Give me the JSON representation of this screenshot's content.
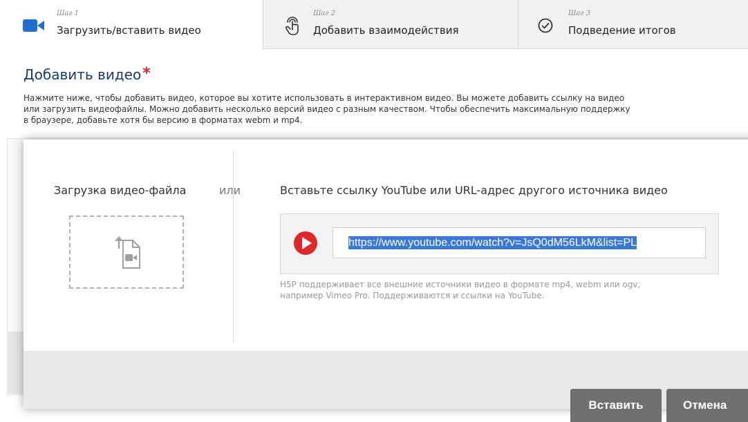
{
  "tabs": [
    {
      "step": "Шаг 1",
      "label": "Загрузить/вставить видео",
      "icon": "video-camera-icon",
      "active": true
    },
    {
      "step": "Шаг 2",
      "label": "Добавить взаимодействия",
      "icon": "tap-gesture-icon",
      "active": false
    },
    {
      "step": "Шаг 3",
      "label": "Подведение итогов",
      "icon": "check-circle-icon",
      "active": false
    }
  ],
  "page": {
    "title": "Добавить видео",
    "required_mark": "*",
    "description_lines": [
      "Нажмите ниже, чтобы добавить видео, которое вы хотите использовать в интерактивном видео. Вы можете добавить ссылку на видео",
      "или загрузить видеофайлы. Можно добавить несколько версий видео с разным качеством. Чтобы обеспечить максимальную поддержку",
      "в браузере, добавьте хотя бы версию в форматах webm и mp4."
    ]
  },
  "dialog": {
    "upload_title": "Загрузка видео-файла",
    "or_text": "или",
    "upload_icon": "upload-video-file-icon",
    "url_title": "Вставьте ссылку YouTube или URL-адрес другого источника видео",
    "youtube_icon": "youtube-play-icon",
    "url_value": "https://www.youtube.com/watch?v=JsQ0dM56LkM&list=PL",
    "help_lines": [
      "H5P поддерживает все внешние источники видео в формате mp4, webm или ogv,",
      "например Vimeo Pro. Поддерживаются и ссылки на YouTube."
    ],
    "insert_label": "Вставить",
    "cancel_label": "Отмена"
  },
  "colors": {
    "title_blue": "#1a3c6e",
    "accent_blue": "#1f6fd1",
    "required_red": "#d8262b",
    "youtube_red": "#e02626",
    "button_gray": "#707070"
  }
}
